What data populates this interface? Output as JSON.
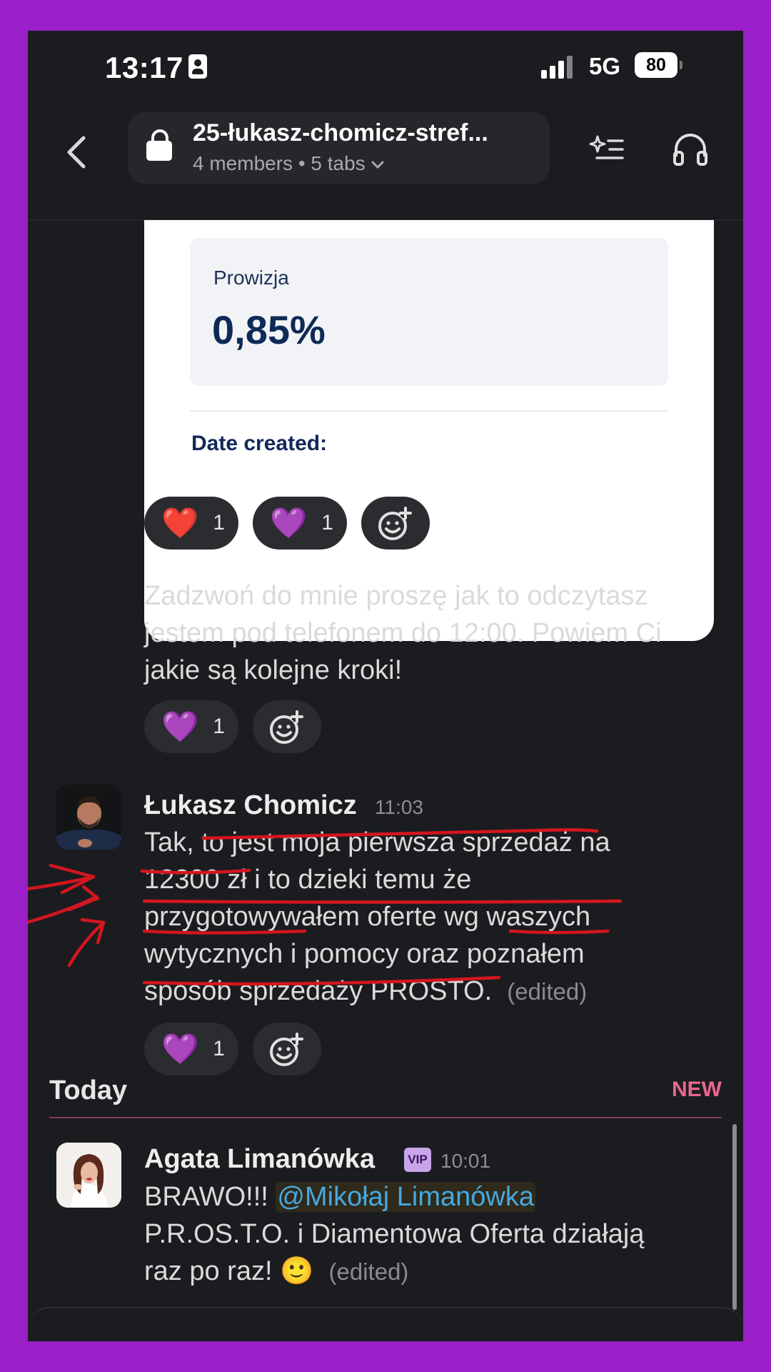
{
  "status_bar": {
    "time": "13:17",
    "network": "5G",
    "battery": "80"
  },
  "header": {
    "channel_name": "25-łukasz-chomicz-stref...",
    "members": "4 members",
    "separator": "•",
    "tabs": "5 tabs",
    "icons": [
      "back-chevron-icon",
      "lock-icon",
      "chevron-down-icon",
      "sparkle-list-icon",
      "headphones-icon"
    ]
  },
  "image_card": {
    "label": "Prowizja",
    "value": "0,85%",
    "date_label": "Date created:"
  },
  "message1": {
    "reactions": [
      {
        "emoji": "❤️",
        "count": "1"
      },
      {
        "emoji": "💜",
        "count": "1"
      }
    ]
  },
  "message2": {
    "text": "Zadzwoń do mnie proszę jak to odczytasz jestem pod telefonem do 12:00. Powiem Ci jakie są kolejne kroki!",
    "reactions": [
      {
        "emoji": "💜",
        "count": "1"
      }
    ]
  },
  "message3": {
    "author": "Łukasz Chomicz",
    "time": "11:03",
    "text_lines": [
      "Tak, to jest moja pierwsza sprzedaż na",
      "12300 zł i to dzieki temu że",
      "przygotowywałem oferte wg waszych",
      "wytycznych i pomocy oraz poznałem",
      "sposób sprzedaży PROSTO."
    ],
    "edited": "(edited)",
    "reactions": [
      {
        "emoji": "💜",
        "count": "1"
      }
    ]
  },
  "divider": {
    "label": "Today",
    "new_label": "NEW"
  },
  "message4": {
    "author": "Agata Limanówka",
    "badge": "VIP",
    "time": "10:01",
    "prefix": "BRAWO!!! ",
    "mention": "@Mikołaj Limanówka",
    "line2": "P.R.OS.T.O. i Diamentowa Oferta działają",
    "line3": "raz po raz! ",
    "emoji": "🙂",
    "edited": "(edited)"
  },
  "colors": {
    "background": "#9a1fc8",
    "app_bg": "#1b1c1f",
    "mention": "#46a9de",
    "new_tag": "#e8678e",
    "annotation": "#d2161e"
  }
}
